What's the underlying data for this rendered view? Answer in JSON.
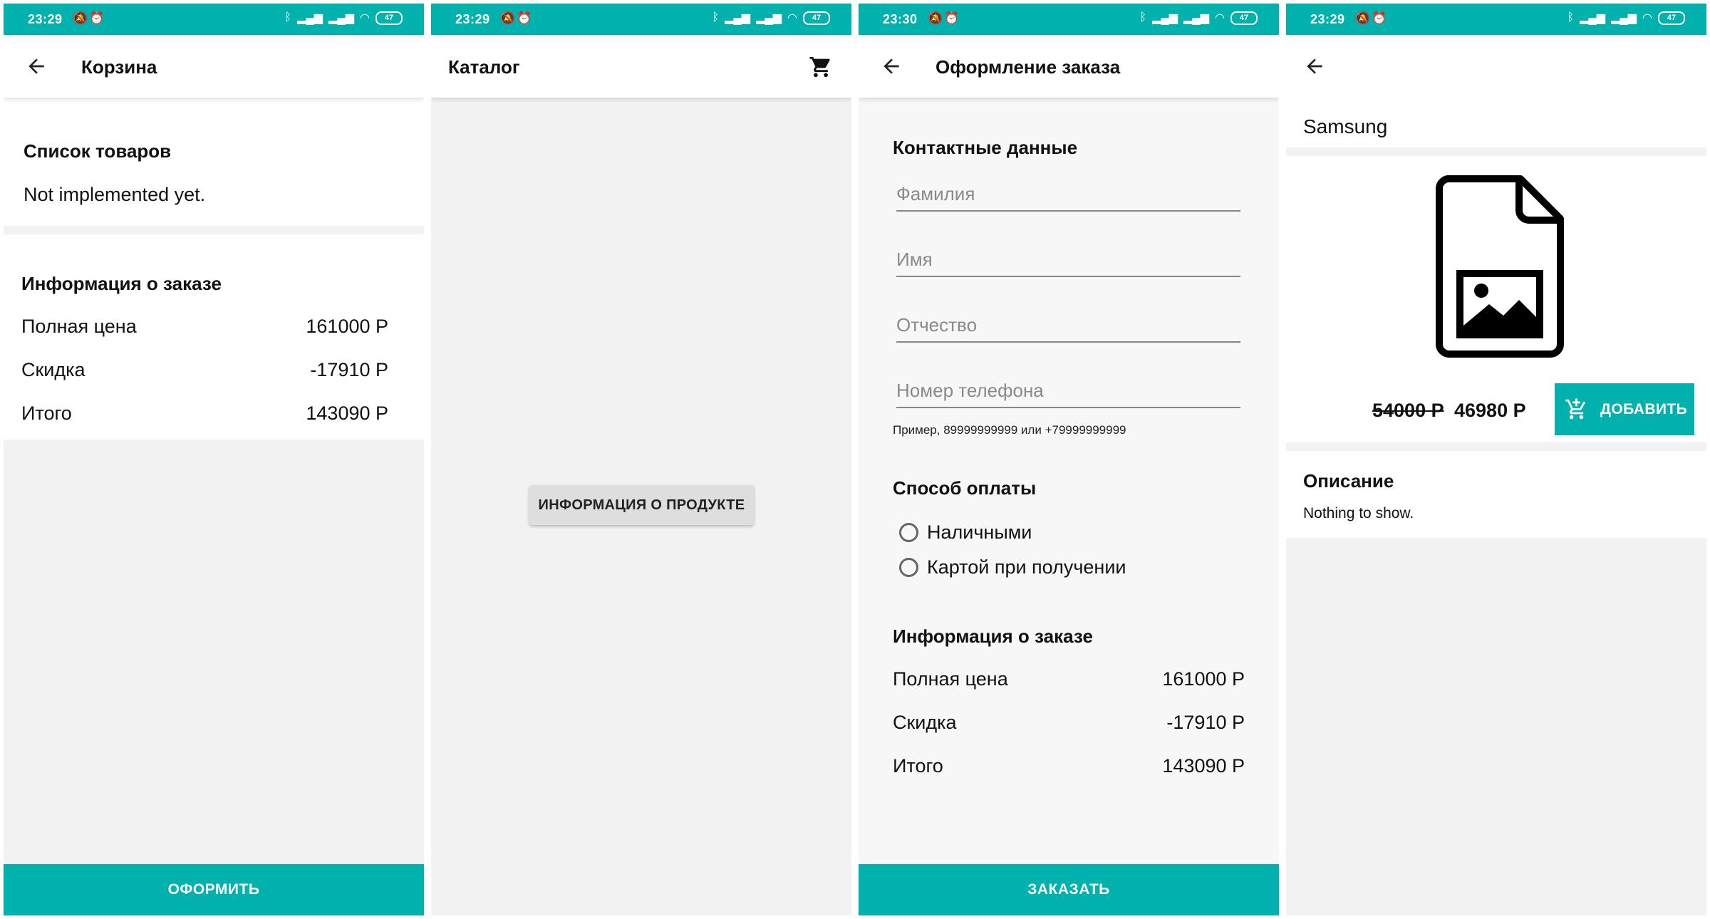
{
  "status": {
    "time1": "23:29",
    "time2": "23:29",
    "time3": "23:30",
    "time4": "23:29",
    "battery": "47"
  },
  "cart": {
    "title": "Корзина",
    "products_heading": "Список товаров",
    "products_placeholder": "Not implemented yet.",
    "order_heading": "Информация о заказе",
    "full_price_label": "Полная цена",
    "full_price_value": "161000 Р",
    "discount_label": "Скидка",
    "discount_value": "-17910 Р",
    "total_label": "Итого",
    "total_value": "143090 Р",
    "checkout_button": "ОФОРМИТЬ"
  },
  "catalog": {
    "title": "Каталог",
    "product_info_button": "ИНФОРМАЦИЯ О ПРОДУКТЕ"
  },
  "checkout": {
    "title": "Оформление заказа",
    "contact_heading": "Контактные данные",
    "surname_placeholder": "Фамилия",
    "name_placeholder": "Имя",
    "patronymic_placeholder": "Отчество",
    "phone_placeholder": "Номер телефона",
    "phone_hint": "Пример, 89999999999 или +79999999999",
    "payment_heading": "Способ оплаты",
    "payment_cash": "Наличными",
    "payment_card": "Картой при получении",
    "order_heading": "Информация о заказе",
    "full_price_label": "Полная цена",
    "full_price_value": "161000 Р",
    "discount_label": "Скидка",
    "discount_value": "-17910 Р",
    "total_label": "Итого",
    "total_value": "143090 Р",
    "order_button": "ЗАКАЗАТЬ"
  },
  "product": {
    "name": "Samsung",
    "old_price": "54000 Р",
    "new_price": "46980 Р",
    "add_button": "ДОБАВИТЬ",
    "description_heading": "Описание",
    "description_text": "Nothing to show."
  },
  "colors": {
    "accent": "#00b1ad",
    "background": "#f2f2f2",
    "surface": "#ffffff"
  }
}
